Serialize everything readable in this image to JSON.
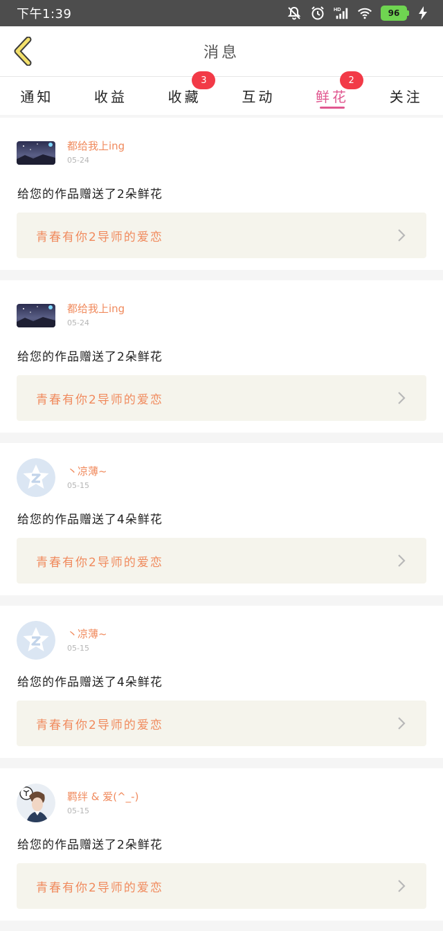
{
  "status_bar": {
    "time": "下午1:39",
    "battery": "96",
    "icons": [
      "bell-muted-icon",
      "alarm-icon",
      "signal-hd-icon",
      "wifi-icon",
      "battery-icon",
      "charging-icon"
    ]
  },
  "header": {
    "title": "消息"
  },
  "tabs": [
    {
      "label": "通知",
      "badge": "",
      "active": false
    },
    {
      "label": "收益",
      "badge": "",
      "active": false
    },
    {
      "label": "收藏",
      "badge": "3",
      "active": false
    },
    {
      "label": "互动",
      "badge": "",
      "active": false
    },
    {
      "label": "鲜花",
      "badge": "2",
      "active": true
    },
    {
      "label": "关注",
      "badge": "",
      "active": false
    }
  ],
  "messages": [
    {
      "user": "都给我上ing",
      "date": "05-24",
      "text": "给您的作品赠送了2朵鲜花",
      "work": "青春有你2导师的爱恋",
      "avatar": "night-sky"
    },
    {
      "user": "都给我上ing",
      "date": "05-24",
      "text": "给您的作品赠送了2朵鲜花",
      "work": "青春有你2导师的爱恋",
      "avatar": "night-sky"
    },
    {
      "user": "丶凉薄~",
      "date": "05-15",
      "text": "给您的作品赠送了4朵鲜花",
      "work": "青春有你2导师的爱恋",
      "avatar": "default"
    },
    {
      "user": "丶凉薄~",
      "date": "05-15",
      "text": "给您的作品赠送了4朵鲜花",
      "work": "青春有你2导师的爱恋",
      "avatar": "default"
    },
    {
      "user": "羁绊 & 爱(^_-)",
      "date": "05-15",
      "text": "给您的作品赠送了2朵鲜花",
      "work": "青春有你2导师的爱恋",
      "avatar": "portrait"
    }
  ],
  "colors": {
    "status_bar": "#4d4d4d",
    "accent_pink": "#e0578f",
    "badge_red": "#f23a47",
    "username_orange": "#f08a5d",
    "back_arrow_yellow": "#f3e06b",
    "card_inner_bg": "#f5f4ec"
  }
}
